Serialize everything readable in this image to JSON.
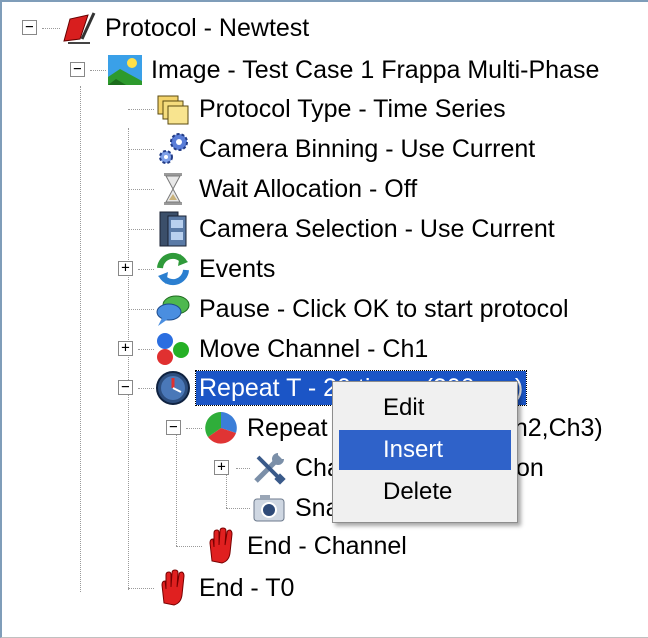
{
  "tree": {
    "nodes": [
      {
        "label": "Protocol - Newtest",
        "icon": "protocol-pen-icon"
      },
      {
        "label": "Image - Test Case 1 Frappa Multi-Phase",
        "icon": "landscape-image-icon"
      },
      {
        "label": "Protocol Type - Time Series",
        "icon": "folders-icon"
      },
      {
        "label": "Camera Binning - Use Current",
        "icon": "gears-icon"
      },
      {
        "label": "Wait Allocation - Off",
        "icon": "hourglass-icon"
      },
      {
        "label": "Camera Selection - Use Current",
        "icon": "film-icon"
      },
      {
        "label": "Events",
        "icon": "refresh-arrows-icon"
      },
      {
        "label": "Pause - Click OK to start protocol",
        "icon": "speech-bubble-icon"
      },
      {
        "label": "Move Channel - Ch1",
        "icon": "rgb-dots-icon"
      },
      {
        "label": "Repeat T - 20 times (200 ms)",
        "icon": "clock-icon"
      },
      {
        "label": "Repeat Channel (Ch1,Ch2,Ch3)",
        "icon": "pie-chart-icon"
      },
      {
        "label": "Channel Configuration",
        "icon": "tools-icon"
      },
      {
        "label": "Snap",
        "icon": "camera-icon"
      },
      {
        "label": "End - Channel",
        "icon": "red-hand-icon"
      },
      {
        "label": "End - T0",
        "icon": "red-hand-icon"
      }
    ]
  },
  "context_menu": {
    "items": [
      "Edit",
      "Insert",
      "Delete"
    ],
    "highlighted": "Insert"
  },
  "colors": {
    "selection": "#1b55c6",
    "menu_highlight": "#2f62c9"
  }
}
